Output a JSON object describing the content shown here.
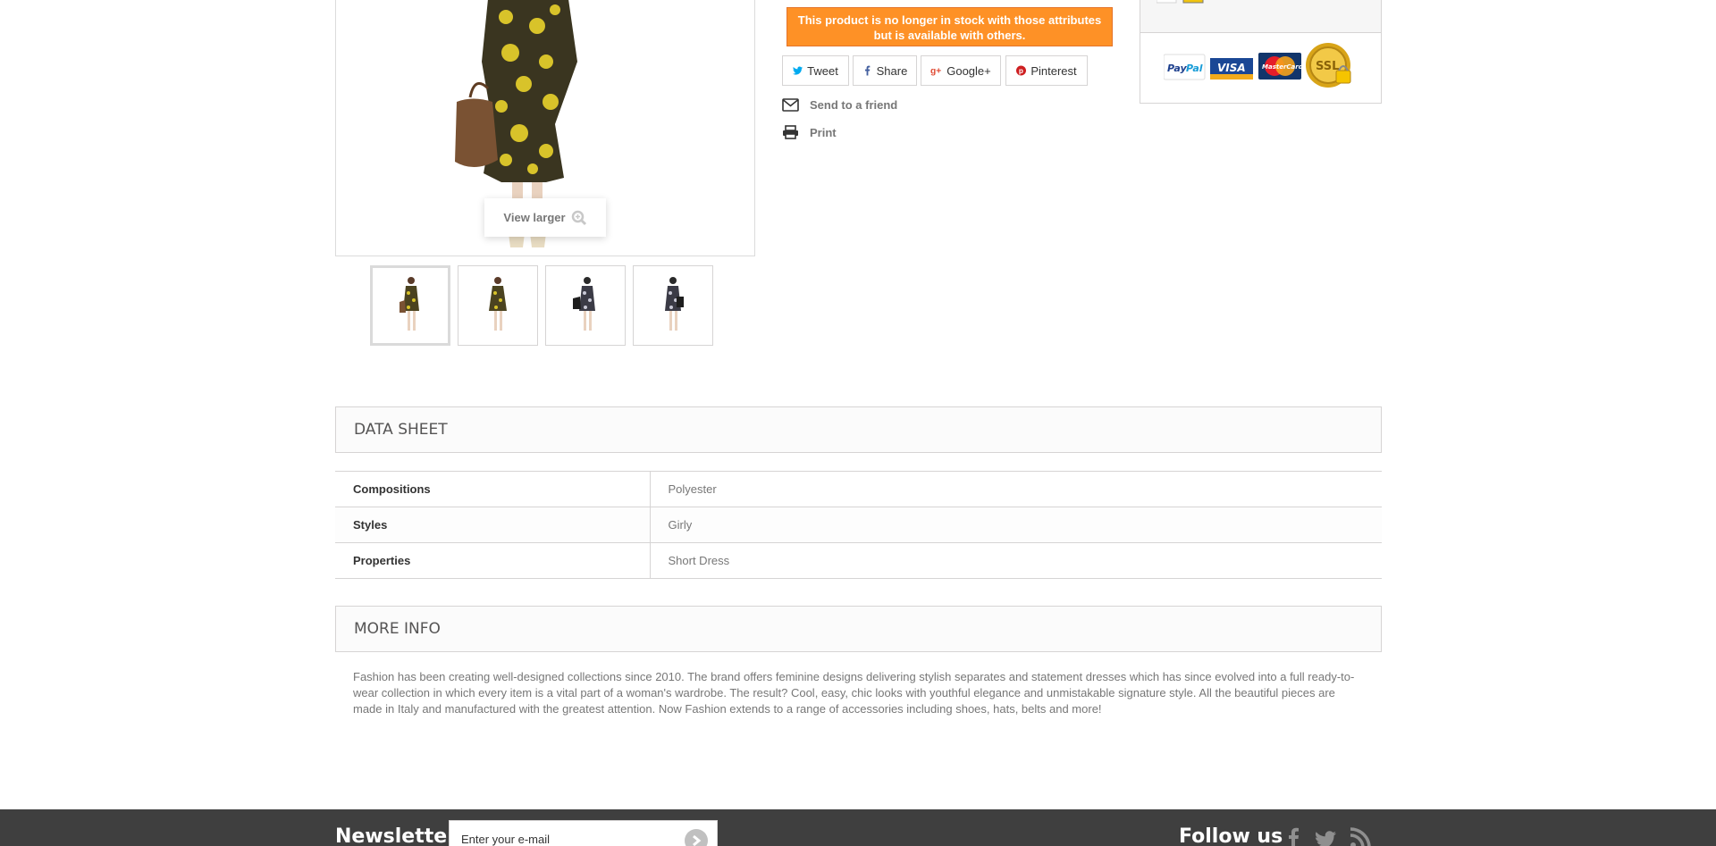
{
  "product": {
    "view_larger_label": "View larger",
    "stock_alert_line1": "This product is no longer in stock with those attributes",
    "stock_alert_line2": "but is available with others.",
    "share": {
      "tweet": "Tweet",
      "share": "Share",
      "google": "Google+",
      "pinterest": "Pinterest"
    },
    "send_to_friend": "Send to a friend",
    "print": "Print",
    "thumbnails": [
      "yellow-dress-front",
      "yellow-dress-side",
      "print-dress-bag",
      "print-dress-front"
    ]
  },
  "payment_logos": [
    "PayPal",
    "VISA",
    "MasterCard",
    "SSL"
  ],
  "data_sheet": {
    "title": "DATA SHEET",
    "rows": [
      {
        "key": "Compositions",
        "value": "Polyester"
      },
      {
        "key": "Styles",
        "value": "Girly"
      },
      {
        "key": "Properties",
        "value": "Short Dress"
      }
    ]
  },
  "more_info": {
    "title": "MORE INFO",
    "text": "Fashion has been creating well-designed collections since 2010. The brand offers feminine designs delivering stylish separates and statement dresses which has since evolved into a full ready-to-wear collection in which every item is a vital part of a woman's wardrobe. The result? Cool, easy, chic looks with youthful elegance and unmistakable signature style. All the beautiful pieces are made in Italy and manufactured with the greatest attention. Now Fashion extends to a range of accessories including shoes, hats, belts and more!"
  },
  "footer": {
    "newsletter_title": "Newsletter",
    "newsletter_placeholder": "Enter your e-mail",
    "follow_title": "Follow us",
    "social_icons": [
      "facebook-icon",
      "twitter-icon",
      "rss-icon"
    ]
  },
  "colors": {
    "stock_alert_bg": "#fe9126",
    "footer_bg": "#3f3f3f",
    "border": "#d6d4d4"
  }
}
